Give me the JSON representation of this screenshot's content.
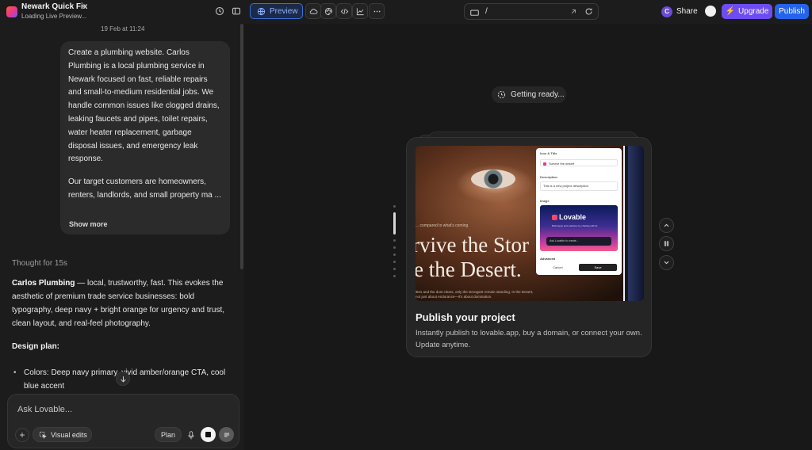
{
  "app": {
    "project_title": "Newark Quick Fix",
    "project_status": "Loading Live Preview..."
  },
  "toolbar": {
    "preview_label": "Preview",
    "url_path": "/",
    "avatar_initial": "C",
    "share_label": "Share",
    "upgrade_label": "Upgrade",
    "publish_label": "Publish"
  },
  "chat": {
    "date": "19 Feb at 11:24",
    "user_message": {
      "paragraph_1": "Create a plumbing website. Carlos Plumbing is a local plumbing service in Newark focused on fast, reliable repairs and small-to-medium residential jobs. We handle common issues like clogged drains, leaking faucets and pipes, toilet repairs, water heater replacement, garbage disposal issues, and emergency leak response.",
      "paragraph_2": "Our target customers are homeowners, renters, landlords, and small property ma ...",
      "show_more": "Show more"
    },
    "thought": "Thought for 15s",
    "response": {
      "brand": "Carlos Plumbing",
      "intro": " — local, trustworthy, fast. This evokes the aesthetic of premium trade service businesses: bold typography, deep navy + bright orange for urgency and trust, clean layout, and real-feel photography.",
      "design_plan_title": "Design plan:",
      "bullets": [
        "Colors: Deep navy primary, vivid amber/orange CTA, cool blue accent"
      ]
    },
    "composer": {
      "placeholder": "Ask Lovable...",
      "visual_edits_label": "Visual edits",
      "plan_label": "Plan"
    }
  },
  "preview": {
    "status_pill": "Getting ready...",
    "card": {
      "title": "Publish your project",
      "description": "Instantly publish to lovable.app, buy a domain, or connect your own. Update anytime.",
      "thumbnail": {
        "hero_small": "... compared to what's coming",
        "hero_line_1": "rvive the Stor",
        "hero_line_2": "e the Desert.",
        "hero_footer": "ittes and the dust clears, only the strongest remain standing. In the Desert, not just about endurance—it's about domination.",
        "dialog": {
          "icon_title_label": "Icon & Title",
          "title_value": "Survive the desert",
          "description_label": "Description",
          "description_value": "This is a new project description",
          "image_label": "Image",
          "logo_text": "Lovable",
          "tagline": "Build apps and websites by chatting with AI",
          "ask_text": "Ask Lovable to create...",
          "advanced_label": "Advanced",
          "cancel_label": "Cancel",
          "save_label": "Save"
        }
      }
    },
    "carousel": {
      "slide_count": 8,
      "active_index": 0
    }
  }
}
